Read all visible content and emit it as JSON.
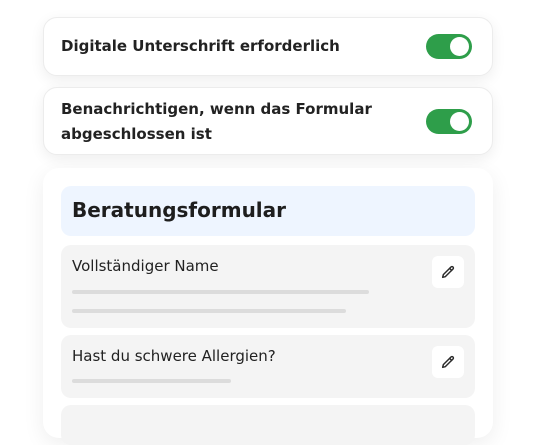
{
  "settings": {
    "items": [
      {
        "label": "Digitale Unterschrift erforderlich",
        "enabled": true
      },
      {
        "label": "Benachrichtigen, wenn das Formular abgeschlossen ist",
        "enabled": true
      }
    ]
  },
  "form": {
    "title": "Beratungsformular",
    "fields": [
      {
        "label": "Vollständiger Name",
        "icon": "pencil-icon"
      },
      {
        "label": "Hast du schwere Allergien?",
        "icon": "pencil-icon"
      }
    ]
  },
  "colors": {
    "toggle_on": "#2e9e4a",
    "header_bg": "#eef5ff",
    "field_bg": "#f4f4f4"
  }
}
